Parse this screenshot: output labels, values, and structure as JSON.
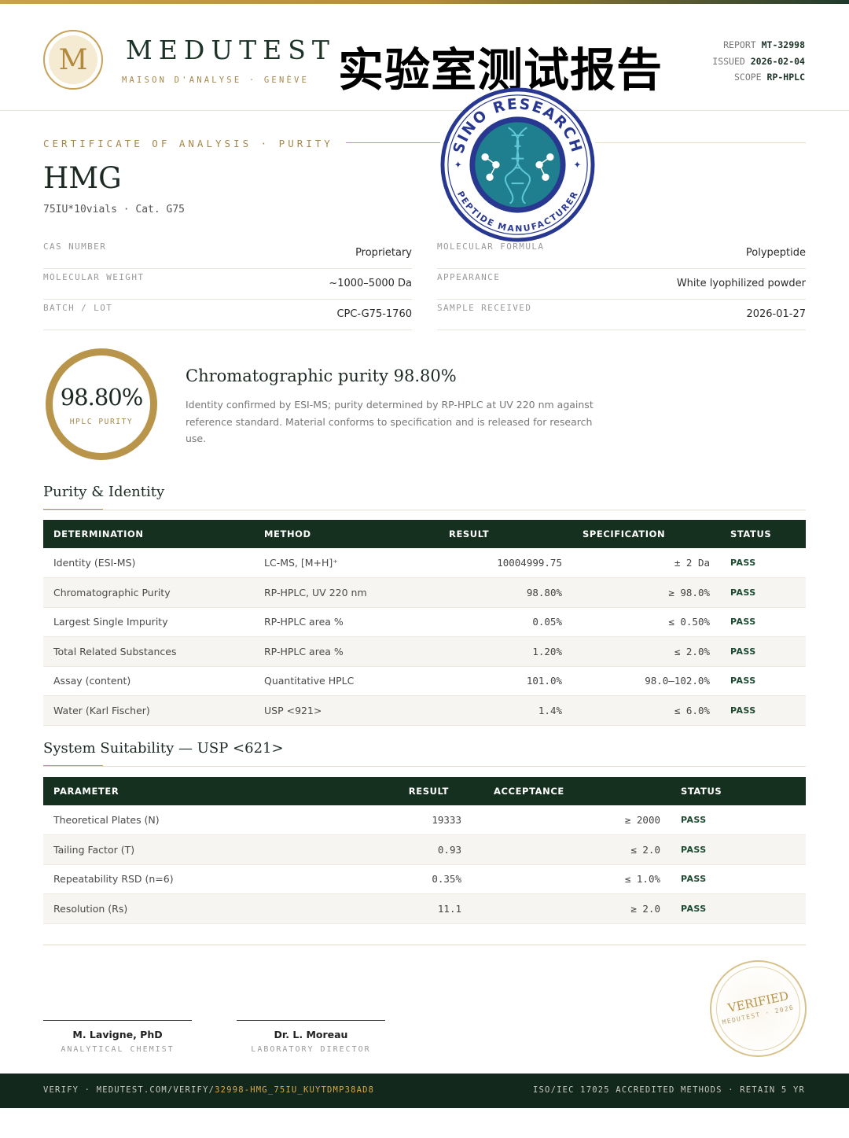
{
  "header": {
    "logo_letter": "M",
    "brand": "MEDUTEST",
    "brand_sub": "MAISON D'ANALYSE · GENÈVE",
    "big_title": "实验室测试报告",
    "report_label": "REPORT",
    "report_value": "MT-32998",
    "issued_label": "ISSUED",
    "issued_value": "2026-02-04",
    "scope_label": "SCOPE",
    "scope_value": "RP-HPLC"
  },
  "seal": {
    "top_text": "SINO RESEARCH",
    "bottom_text": "PEPTIDE MANUFACTURER",
    "colors": {
      "navy": "#283891",
      "teal": "#1f7f8f",
      "accent": "#5fc7d6"
    }
  },
  "cert": {
    "label": "CERTIFICATE OF ANALYSIS · PURITY",
    "product": "HMG",
    "product_sub": "75IU*10vials  ·  Cat. G75"
  },
  "info": {
    "left": [
      {
        "key": "CAS NUMBER",
        "value": "Proprietary"
      },
      {
        "key": "MOLECULAR WEIGHT",
        "value": "~1000–5000 Da"
      },
      {
        "key": "BATCH / LOT",
        "value": "CPC-G75-1760"
      }
    ],
    "right": [
      {
        "key": "MOLECULAR FORMULA",
        "value": "Polypeptide"
      },
      {
        "key": "APPEARANCE",
        "value": "White lyophilized powder"
      },
      {
        "key": "SAMPLE RECEIVED",
        "value": "2026-01-27"
      }
    ]
  },
  "purity": {
    "ring_value": "98.80%",
    "ring_label": "HPLC PURITY",
    "title": "Chromatographic purity 98.80%",
    "description": "Identity confirmed by ESI-MS; purity determined by RP-HPLC at UV 220 nm against reference standard. Material conforms to specification and is released for research use."
  },
  "purity_table": {
    "heading": "Purity & Identity",
    "columns": [
      "DETERMINATION",
      "METHOD",
      "RESULT",
      "SPECIFICATION",
      "STATUS"
    ],
    "rows": [
      [
        "Identity (ESI-MS)",
        "LC-MS, [M+H]⁺",
        "10004999.75",
        "± 2 Da",
        "PASS"
      ],
      [
        "Chromatographic Purity",
        "RP-HPLC, UV 220 nm",
        "98.80%",
        "≥ 98.0%",
        "PASS"
      ],
      [
        "Largest Single Impurity",
        "RP-HPLC area %",
        "0.05%",
        "≤ 0.50%",
        "PASS"
      ],
      [
        "Total Related Substances",
        "RP-HPLC area %",
        "1.20%",
        "≤ 2.0%",
        "PASS"
      ],
      [
        "Assay (content)",
        "Quantitative HPLC",
        "101.0%",
        "98.0–102.0%",
        "PASS"
      ],
      [
        "Water (Karl Fischer)",
        "USP <921>",
        "1.4%",
        "≤ 6.0%",
        "PASS"
      ]
    ]
  },
  "suitability_table": {
    "heading": "System Suitability — USP <621>",
    "columns": [
      "PARAMETER",
      "RESULT",
      "ACCEPTANCE",
      "STATUS"
    ],
    "rows": [
      [
        "Theoretical Plates (N)",
        "19333",
        "≥ 2000",
        "PASS"
      ],
      [
        "Tailing Factor (T)",
        "0.93",
        "≤ 2.0",
        "PASS"
      ],
      [
        "Repeatability RSD (n=6)",
        "0.35%",
        "≤ 1.0%",
        "PASS"
      ],
      [
        "Resolution (Rs)",
        "11.1",
        "≥ 2.0",
        "PASS"
      ]
    ]
  },
  "signatures": [
    {
      "name": "M. Lavigne, PhD",
      "role": "ANALYTICAL CHEMIST"
    },
    {
      "name": "Dr. L. Moreau",
      "role": "LABORATORY DIRECTOR"
    }
  ],
  "stamp": {
    "word": "VERIFIED",
    "sub": "MEDUTEST · 2026"
  },
  "footer": {
    "verify_prefix": "VERIFY · MEDUTEST.COM/VERIFY/",
    "verify_code": "32998-HMG_75IU_KUYTDMP38AD8",
    "right": "ISO/IEC 17025 ACCREDITED METHODS · RETAIN 5 YR"
  }
}
